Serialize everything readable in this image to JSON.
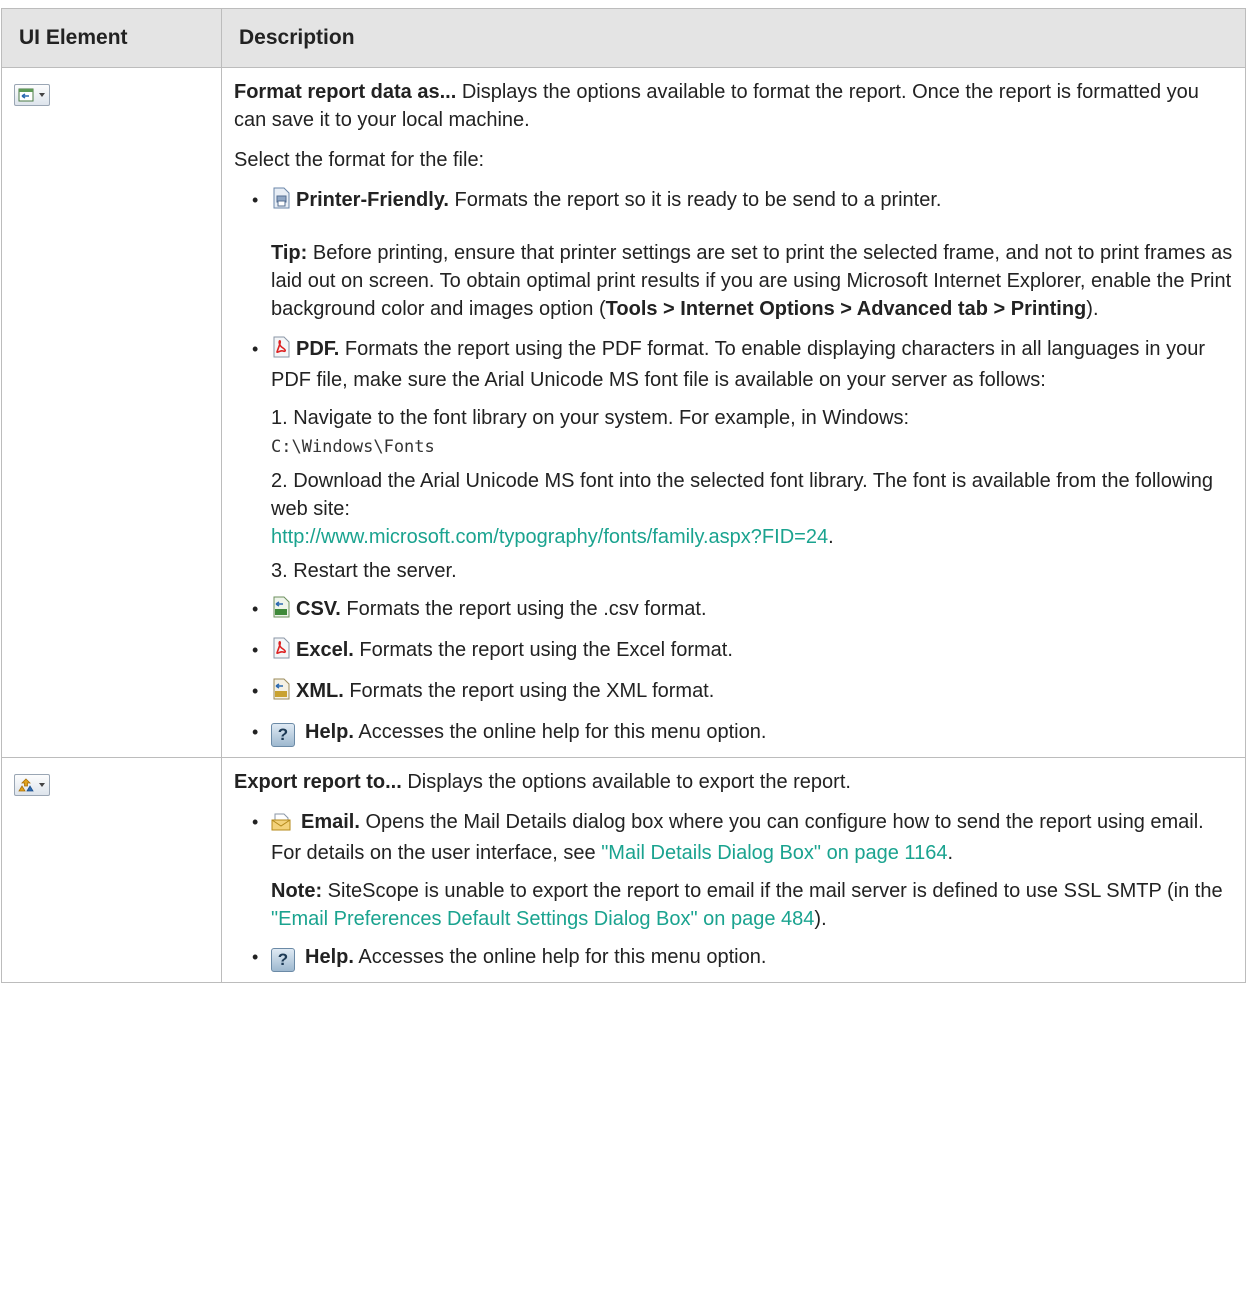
{
  "table": {
    "headers": [
      "UI Element",
      "Description"
    ]
  },
  "row1": {
    "icon": "format-report-dropdown-icon",
    "title": "Format report data as...",
    "intro": " Displays the options available to format the report. Once the report is formatted you can save it to your local machine.",
    "select_label": "Select the format for the file:",
    "printer": {
      "icon": "printer-icon",
      "label": "Printer-Friendly.",
      "text": " Formats the report so it is ready to be send to a printer.",
      "tip_label": "Tip:",
      "tip_text": " Before printing, ensure that printer settings are set to print the selected frame, and not to print frames as laid out on screen. To obtain optimal print results if you are using Microsoft Internet Explorer, enable the Print background color and images option (",
      "tip_path": "Tools > Internet Options > Advanced tab > Printing",
      "tip_end": ")."
    },
    "pdf": {
      "icon": "pdf-icon",
      "label": "PDF.",
      "text": " Formats the report using the PDF format. To enable displaying characters in all languages in your PDF file, make sure the Arial Unicode MS font file is available on your server as follows:",
      "step1": "1. Navigate to the font library on your system. For example, in Windows:",
      "step1_path": "C:\\Windows\\Fonts",
      "step2": "2. Download the Arial Unicode MS font into the selected font library. The font is available from the following web site:",
      "step2_link": "http://www.microsoft.com/typography/fonts/family.aspx?FID=24",
      "step2_end": ".",
      "step3": "3. Restart the server."
    },
    "csv": {
      "icon": "csv-icon",
      "label": "CSV.",
      "text": " Formats the report using the .csv format."
    },
    "excel": {
      "icon": "excel-icon",
      "label": "Excel.",
      "text": " Formats the report using the Excel format."
    },
    "xml": {
      "icon": "xml-icon",
      "label": "XML.",
      "text": " Formats the report using the XML format."
    },
    "help": {
      "icon": "help-icon",
      "glyph": "?",
      "label": "Help.",
      "text": " Accesses the online help for this menu option."
    }
  },
  "row2": {
    "icon": "export-report-dropdown-icon",
    "title": "Export report to...",
    "intro": " Displays the options available to export the report.",
    "email": {
      "icon": "email-icon",
      "label": "Email.",
      "text": " Opens the Mail Details dialog box where you can configure how to send the report using email. For details on the user interface, see ",
      "link": "\"Mail Details Dialog Box\" on page 1164",
      "end": ".",
      "note_label": "Note:",
      "note_text": " SiteScope is unable to export the report to email if the mail server is defined to use SSL SMTP (in the ",
      "note_link": "\"Email Preferences Default Settings Dialog Box\" on page 484",
      "note_end": ")."
    },
    "help": {
      "icon": "help-icon",
      "glyph": "?",
      "label": "Help.",
      "text": " Accesses the online help for this menu option."
    }
  }
}
